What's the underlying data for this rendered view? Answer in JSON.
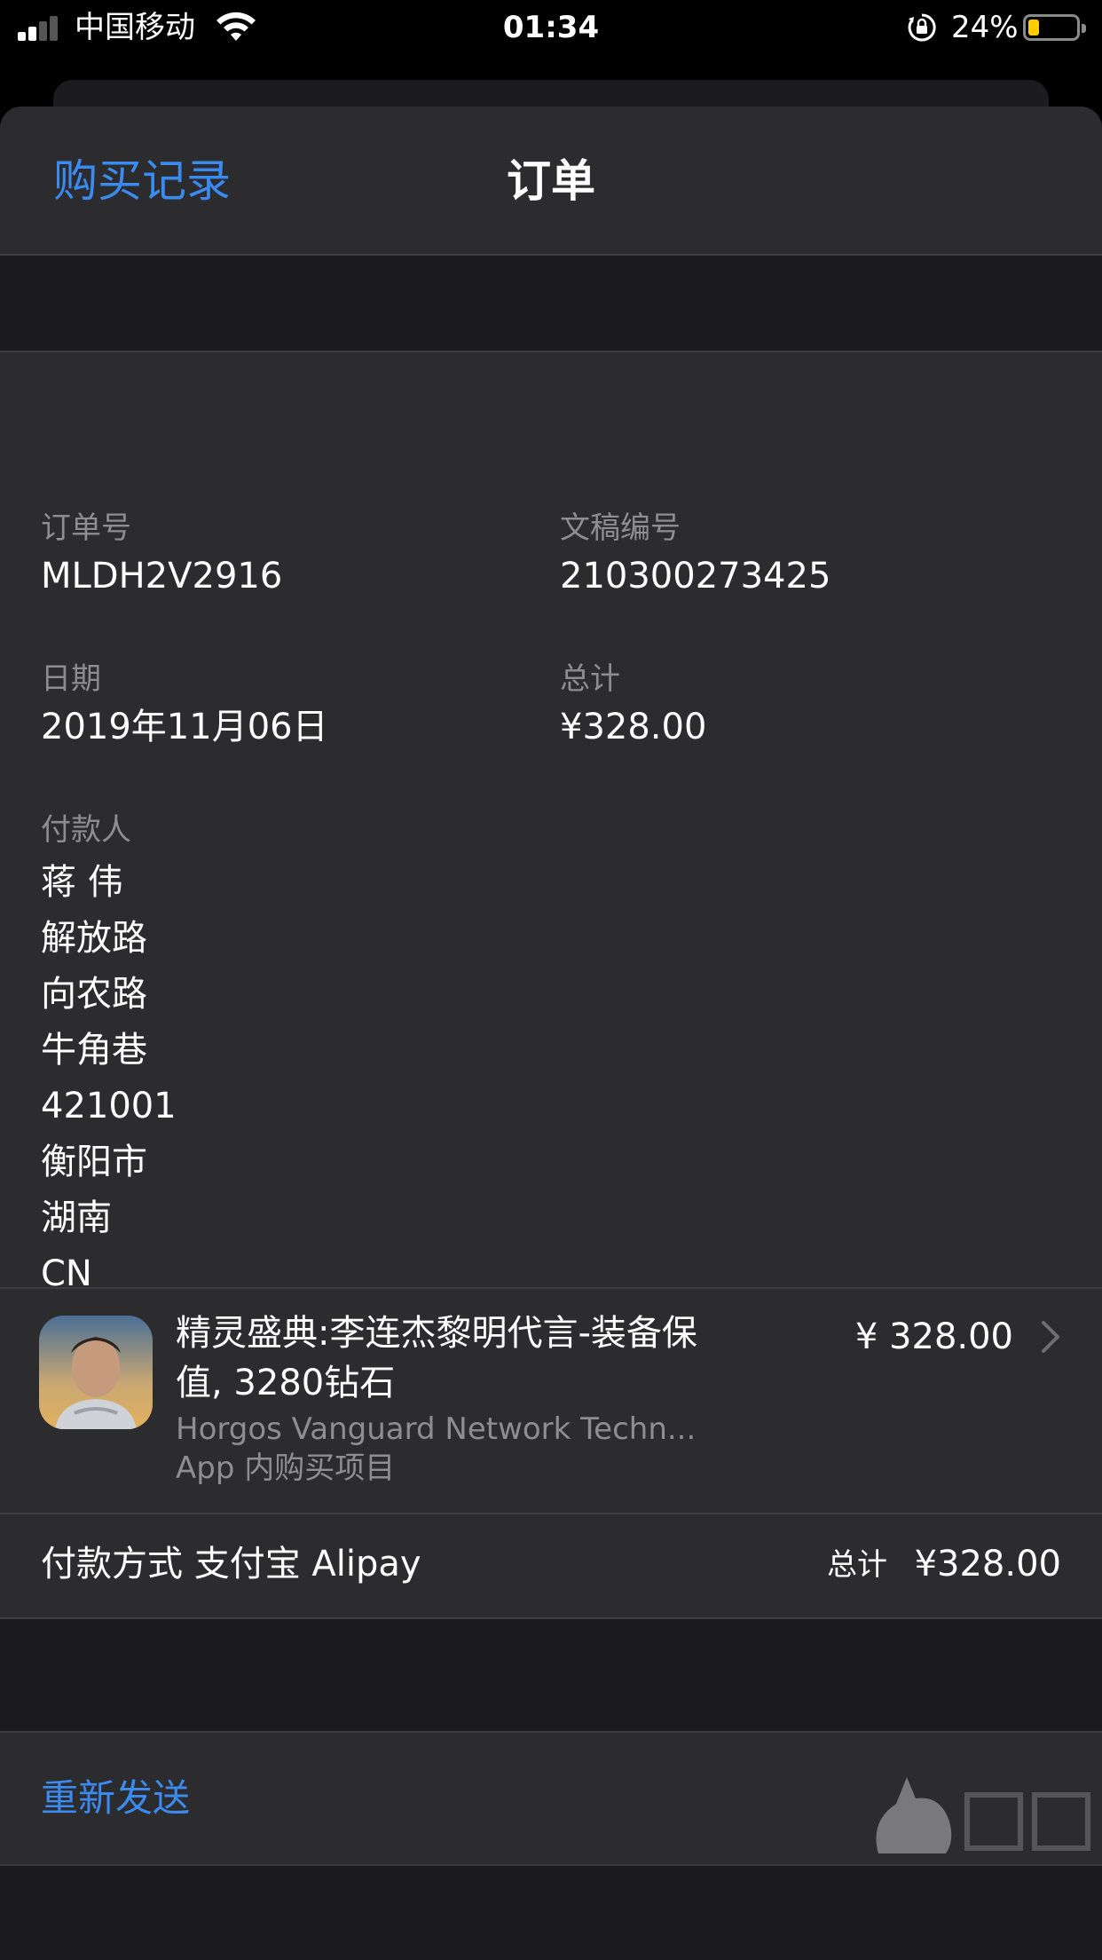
{
  "status_bar": {
    "carrier": "中国移动",
    "time": "01:34",
    "battery_percent": "24%",
    "battery_level": 0.24,
    "icons": [
      "signal-icon",
      "wifi-icon",
      "rotation-lock-icon",
      "battery-icon"
    ]
  },
  "nav": {
    "back_label": "购买记录",
    "title": "订单"
  },
  "order": {
    "order_number_label": "订单号",
    "order_number": "MLDH2V2916",
    "document_number_label": "文稿编号",
    "document_number": "210300273425",
    "date_label": "日期",
    "date": "2019年11月06日",
    "total_label": "总计",
    "total": "¥328.00",
    "payer_label": "付款人",
    "payer_lines": [
      "蒋 伟",
      "解放路",
      "向农路",
      "牛角巷",
      "421001",
      "衡阳市",
      "湖南",
      "CN"
    ]
  },
  "item": {
    "name": "精灵盛典:李连杰黎明代言-装备保值, 3280钻石",
    "developer": "Horgos Vanguard Network Techn...",
    "type": "App 内购买项目",
    "price": "¥ 328.00",
    "icon": "app-icon"
  },
  "payment": {
    "method": "付款方式 支付宝 Alipay",
    "total_label": "总计",
    "total": "¥328.00"
  },
  "actions": {
    "resend_label": "重新发送"
  },
  "colors": {
    "accent": "#3a8aef",
    "sheet_bg": "#2c2c2e",
    "section_gap": "#1c1c1e",
    "secondary_text": "#8d8d93",
    "battery": "#ffcc00"
  }
}
